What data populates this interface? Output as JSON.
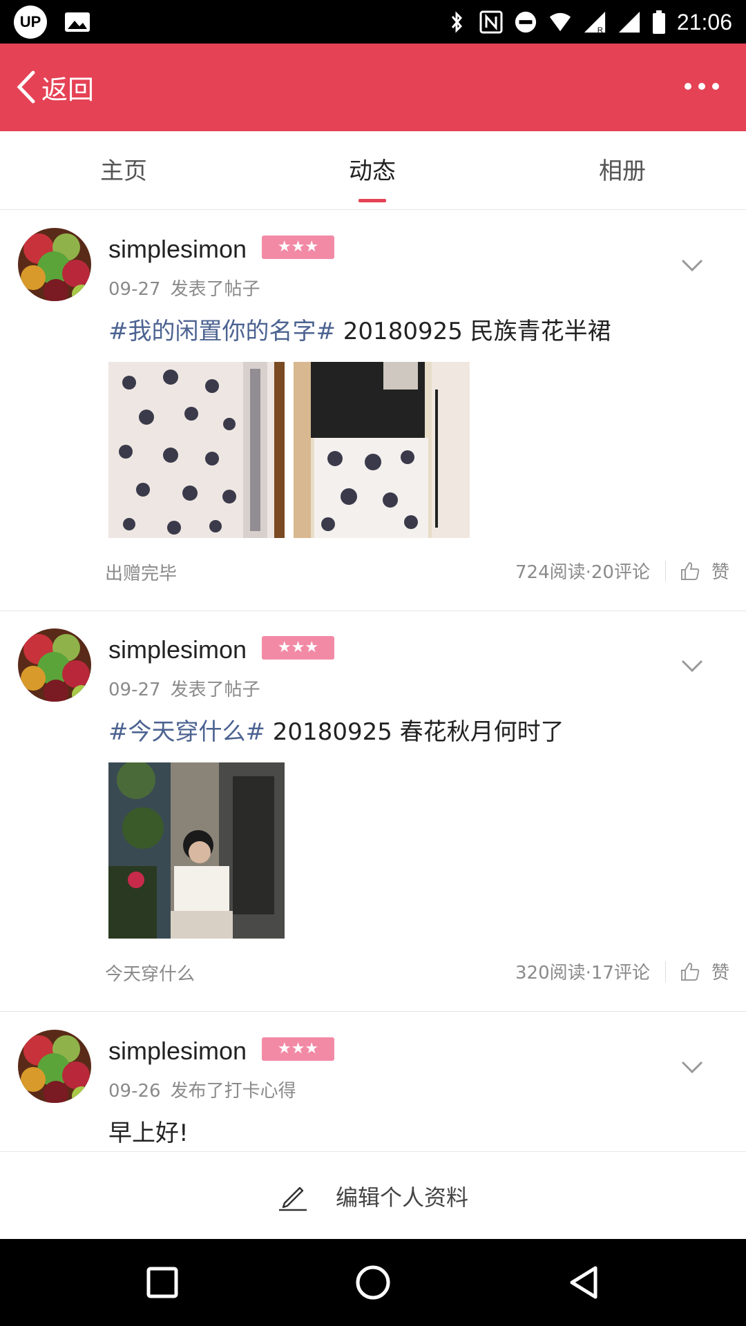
{
  "status_bar": {
    "app_badge": "UP",
    "time": "21:06"
  },
  "header": {
    "back_label": "返回",
    "more_icon": "more-dots-icon"
  },
  "tabs": [
    {
      "label": "主页",
      "active": false
    },
    {
      "label": "动态",
      "active": true
    },
    {
      "label": "相册",
      "active": false
    }
  ],
  "posts": [
    {
      "username": "simplesimon",
      "badge": "★★★",
      "date": "09-27",
      "action": "发表了帖子",
      "tag": "#我的闲置你的名字#",
      "title": " 20180925 民族青花半裙",
      "photo_count": 2,
      "footer_label": "出赠完毕",
      "stats": "724阅读·20评论",
      "like_label": "赞"
    },
    {
      "username": "simplesimon",
      "badge": "★★★",
      "date": "09-27",
      "action": "发表了帖子",
      "tag": "#今天穿什么#",
      "title": " 20180925 春花秋月何时了",
      "photo_count": 1,
      "footer_label": "今天穿什么",
      "stats": "320阅读·17评论",
      "like_label": "赞"
    },
    {
      "username": "simplesimon",
      "badge": "★★★",
      "date": "09-26",
      "action": "发布了打卡心得",
      "tag": "",
      "title": "早上好!"
    }
  ],
  "edit_bar": {
    "label": "编辑个人资料"
  },
  "colors": {
    "brand": "#e54255",
    "tag_link": "#4c6391",
    "badge": "#f28aa6"
  }
}
